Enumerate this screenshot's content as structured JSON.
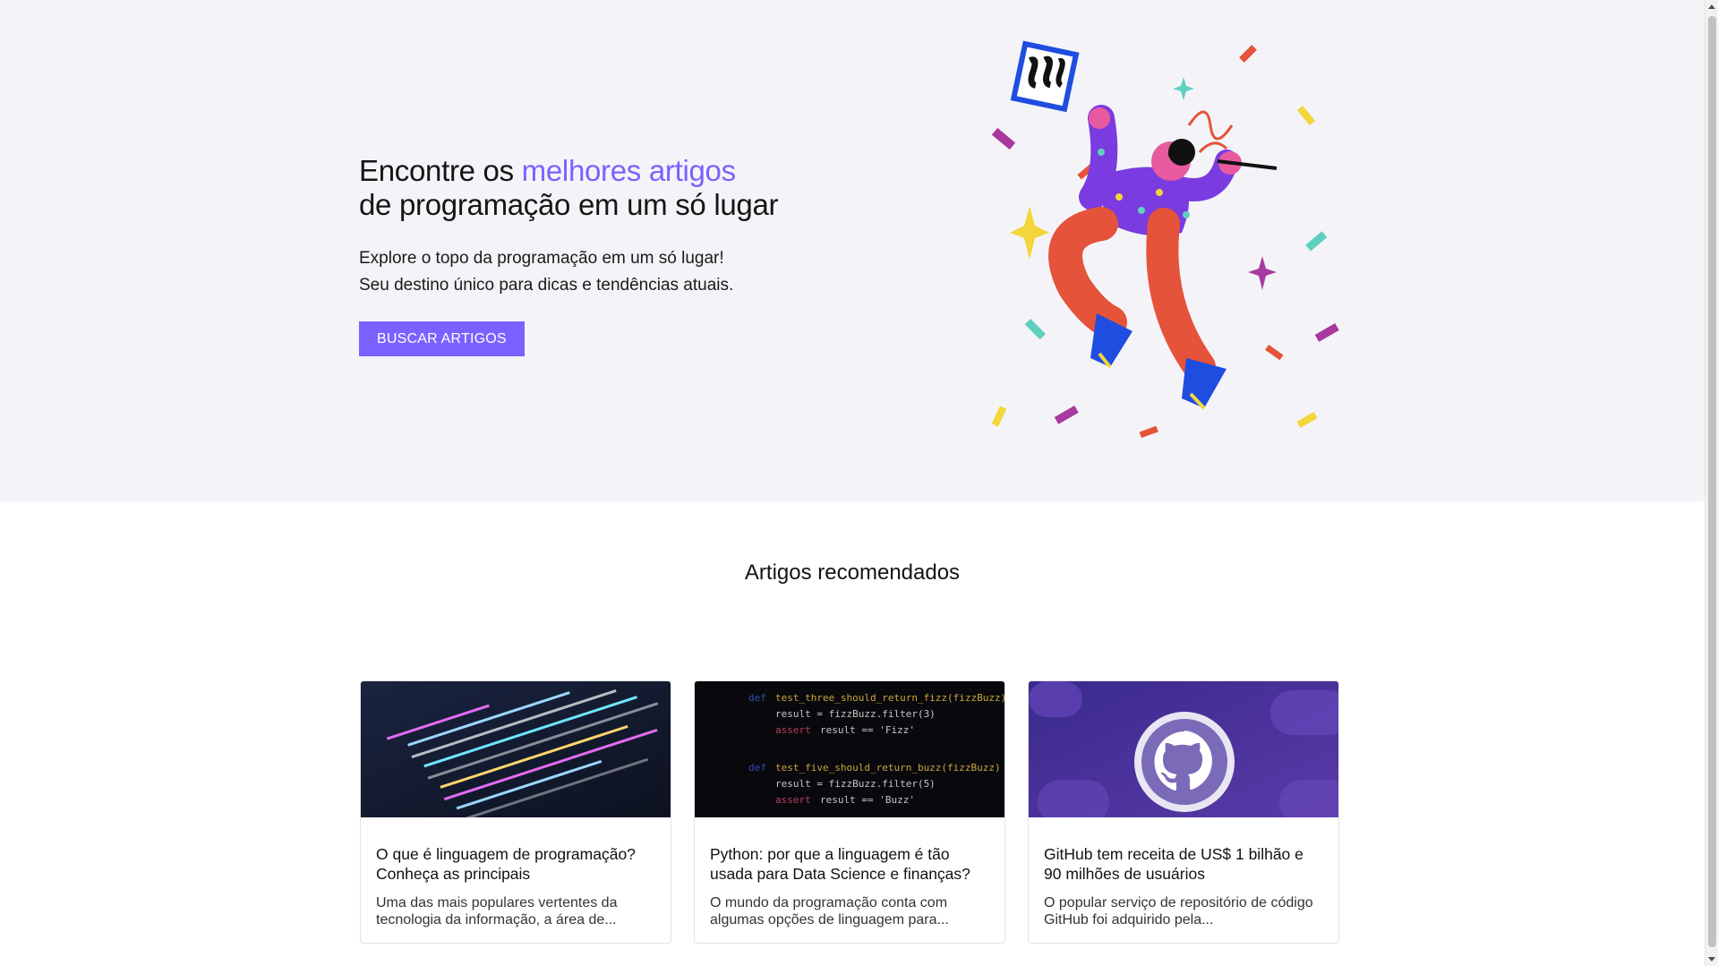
{
  "hero": {
    "title_line1_prefix": "Encontre os ",
    "title_line1_accent": "melhores artigos",
    "title_line2": "de programação em um só lugar",
    "subtitle_line1": "Explore o topo da programação em um só lugar!",
    "subtitle_line2": "Seu destino único para dicas e tendências atuais.",
    "cta_label": "BUSCAR ARTIGOS",
    "illustration_icon": "dancing-programmer-illustration"
  },
  "recommended": {
    "title": "Artigos recomendados",
    "cards": [
      {
        "title": "O que é linguagem de programação? Conheça as principais",
        "excerpt": "Uma das mais populares vertentes da tecnologia da informação, a área de...",
        "thumbnail_icon": "code-editor-image"
      },
      {
        "title": "Python: por que a linguagem é tão usada para Data Science e finanças?",
        "excerpt": "O mundo da programação conta com algumas opções de linguagem para...",
        "thumbnail_icon": "python-code-image"
      },
      {
        "title": "GitHub tem receita de US$ 1 bilhão e 90 milhões de usuários",
        "excerpt": "O popular serviço de repositório de código GitHub foi adquirido pela...",
        "thumbnail_icon": "github-logo-image"
      }
    ]
  },
  "colors": {
    "accent": "#7b61ff",
    "hero_background": "#f4f4f8"
  }
}
